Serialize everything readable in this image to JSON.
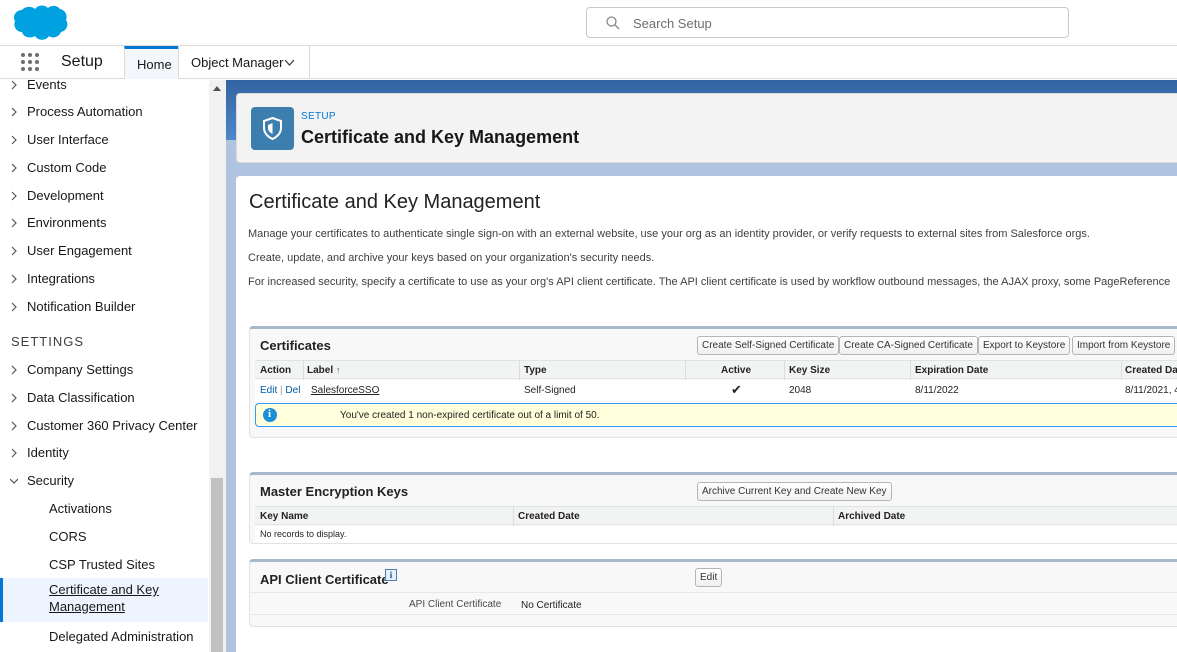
{
  "header": {
    "search_placeholder": "Search Setup",
    "brand_color": "#00a1e0"
  },
  "nav": {
    "app_name": "Setup",
    "tabs": [
      {
        "label": "Home"
      },
      {
        "label": "Object Manager"
      }
    ]
  },
  "sidebar": {
    "items": [
      {
        "label": "Events"
      },
      {
        "label": "Process Automation"
      },
      {
        "label": "User Interface"
      },
      {
        "label": "Custom Code"
      },
      {
        "label": "Development"
      },
      {
        "label": "Environments"
      },
      {
        "label": "User Engagement"
      },
      {
        "label": "Integrations"
      },
      {
        "label": "Notification Builder"
      }
    ],
    "settings_heading": "SETTINGS",
    "settings_items": [
      {
        "label": "Company Settings"
      },
      {
        "label": "Data Classification"
      },
      {
        "label": "Customer 360 Privacy Center"
      },
      {
        "label": "Identity"
      },
      {
        "label": "Security"
      }
    ],
    "security_children": [
      {
        "label": "Activations"
      },
      {
        "label": "CORS"
      },
      {
        "label": "CSP Trusted Sites"
      },
      {
        "label": "Certificate and Key",
        "label2": "Management"
      },
      {
        "label": "Delegated Administration"
      }
    ]
  },
  "page_header": {
    "eyebrow": "SETUP",
    "title": "Certificate and Key Management"
  },
  "content": {
    "title": "Certificate and Key Management",
    "descriptions": [
      "Manage your certificates to authenticate single sign-on with an external website, use your org as an identity provider, or verify requests to external sites from Salesforce orgs.",
      "Create, update, and archive your keys based on your organization's security needs.",
      "For increased security, specify a certificate to use as your org's API client certificate. The API client certificate is used by workflow outbound messages, the AJAX proxy, some PageReference"
    ]
  },
  "certificates": {
    "title": "Certificates",
    "buttons": [
      "Create Self-Signed Certificate",
      "Create CA-Signed Certificate",
      "Export to Keystore",
      "Import from Keystore"
    ],
    "columns": [
      "Action",
      "Label",
      "Type",
      "Active",
      "Key Size",
      "Expiration Date",
      "Created Dat"
    ],
    "sort_indicator": "↑",
    "rows": [
      {
        "edit": "Edit",
        "sep": "|",
        "del": "Del",
        "label": "SalesforceSSO",
        "type": "Self-Signed",
        "active": "✔",
        "key_size": "2048",
        "expiration": "8/11/2022",
        "created": "8/11/2021, 4"
      }
    ],
    "info_message": "You've created 1 non-expired certificate out of a limit of 50."
  },
  "master_keys": {
    "title": "Master Encryption Keys",
    "button": "Archive Current Key and Create New Key",
    "columns": [
      "Key Name",
      "Created Date",
      "Archived Date"
    ],
    "empty_message": "No records to display."
  },
  "api_client": {
    "title": "API Client Certificate",
    "help": "i",
    "button": "Edit",
    "field_label": "API Client Certificate",
    "field_value": "No Certificate"
  }
}
